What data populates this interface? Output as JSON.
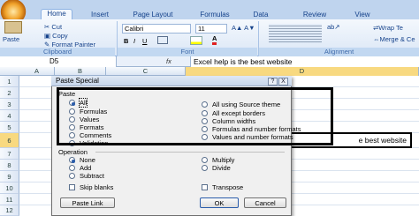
{
  "ribbon": {
    "tabs": [
      "Home",
      "Insert",
      "Page Layout",
      "Formulas",
      "Data",
      "Review",
      "View"
    ],
    "paste_label": "Paste",
    "cut_label": "Cut",
    "copy_label": "Copy",
    "format_painter_label": "Format Painter",
    "font_name": "Calibri",
    "font_size": "11",
    "wrap_text_label": "Wrap Te",
    "merge_label": "Merge & Ce",
    "groups": {
      "clipboard": "Clipboard",
      "font": "Font",
      "alignment": "Alignment"
    }
  },
  "formula_bar": {
    "name_box": "D5",
    "formula": "Excel help is the best website"
  },
  "grid": {
    "columns": [
      "A",
      "B",
      "C",
      "D"
    ],
    "rows": [
      "1",
      "2",
      "3",
      "4",
      "5",
      "6",
      "7",
      "8",
      "9",
      "10",
      "11",
      "12"
    ],
    "cell_d5_visible": "e best website"
  },
  "dialog": {
    "title": "Paste Special",
    "help_glyph": "?",
    "close_glyph": "X",
    "paste_section": "Paste",
    "paste_left": [
      "All",
      "Formulas",
      "Values",
      "Formats",
      "Comments",
      "Validation"
    ],
    "paste_right": [
      "All using Source theme",
      "All except borders",
      "Column widths",
      "Formulas and number formats",
      "Values and number formats"
    ],
    "operation_section": "Operation",
    "op_left": [
      "None",
      "Add",
      "Subtract"
    ],
    "op_right": [
      "Multiply",
      "Divide"
    ],
    "skip_blanks": "Skip blanks",
    "transpose": "Transpose",
    "paste_link": "Paste Link",
    "ok": "OK",
    "cancel": "Cancel",
    "selected_paste": "All",
    "selected_op": "None"
  },
  "colors": {
    "ribbon": "#dbe7f6",
    "highlight_box": "#000000",
    "dialog_bg": "#f0f0f0"
  }
}
